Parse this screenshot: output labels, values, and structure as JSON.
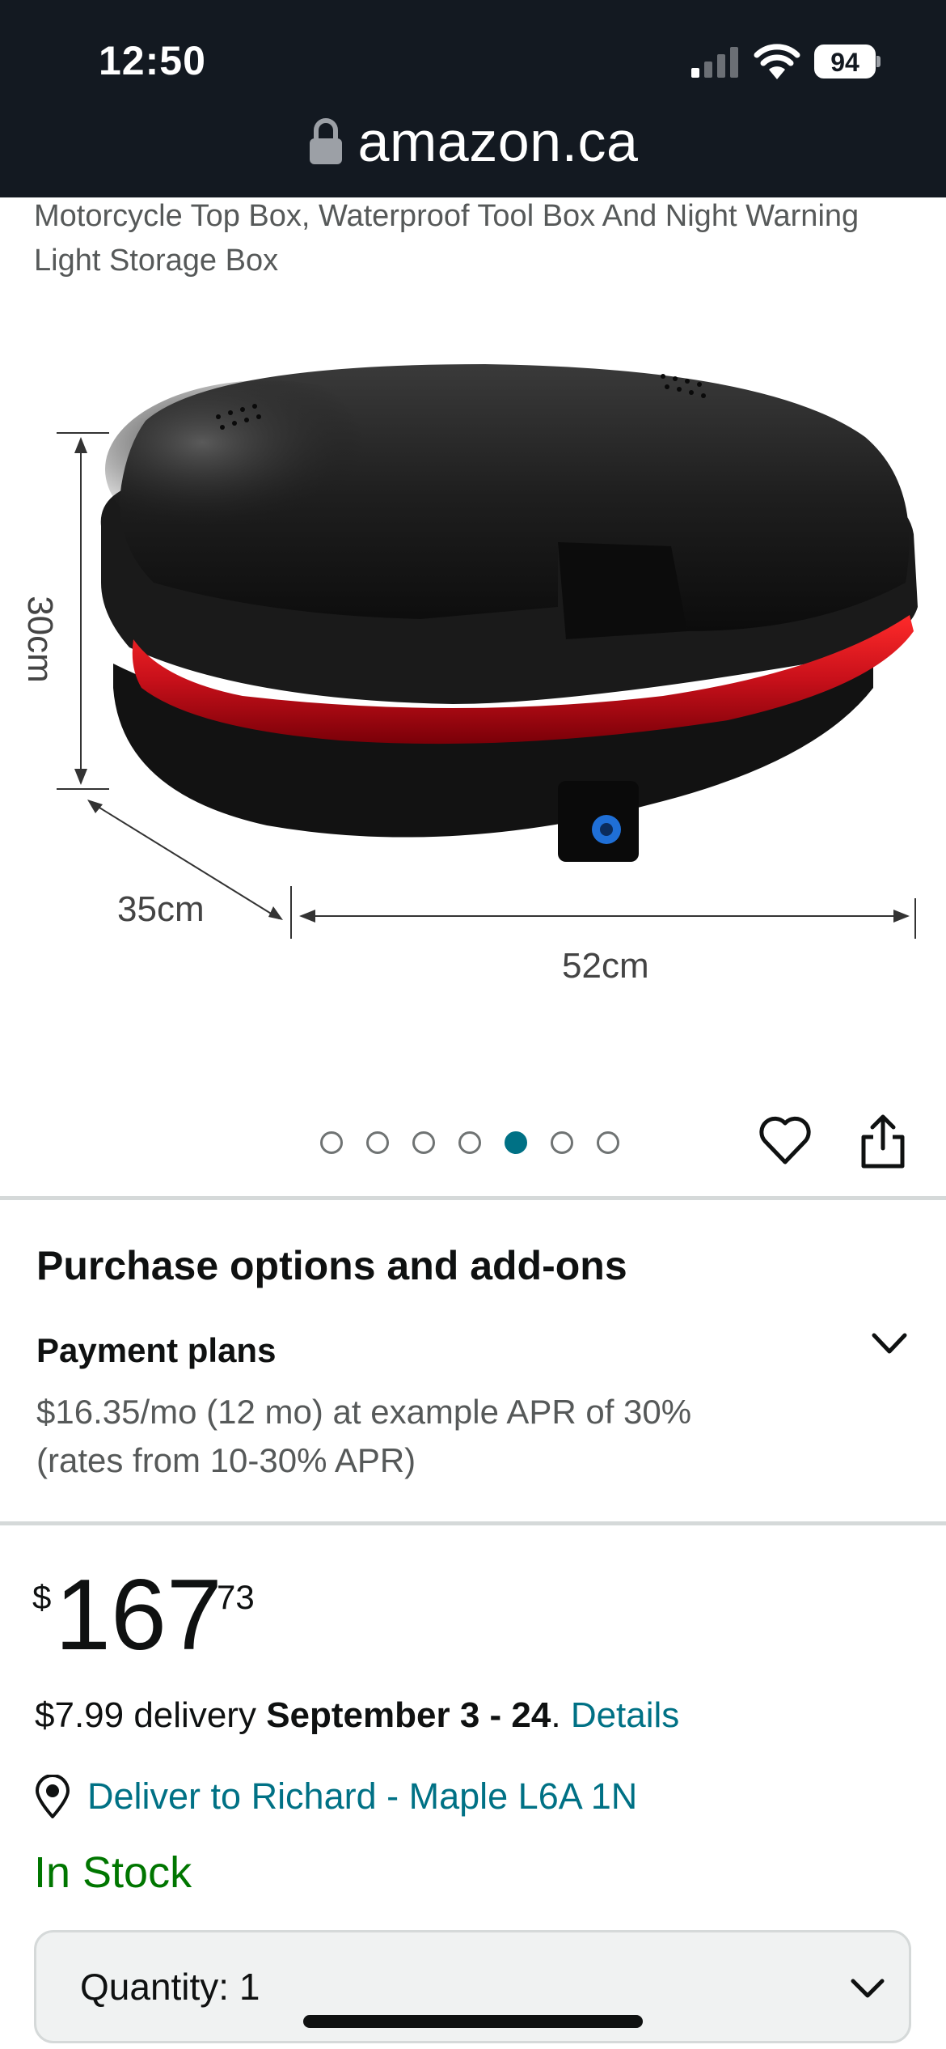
{
  "status_bar": {
    "time": "12:50",
    "battery": "94"
  },
  "browser": {
    "url": "amazon.ca"
  },
  "product": {
    "title": "Motorcycle Top Box, Waterproof Tool Box And Night Warning Light Storage Box",
    "image": {
      "dimension_height": "30cm",
      "dimension_depth": "35cm",
      "dimension_width": "52cm"
    },
    "carousel": {
      "total": 7,
      "active_index": 4
    }
  },
  "purchase_options": {
    "heading": "Purchase options and add-ons",
    "payment_plans_label": "Payment plans",
    "payment_plans_text": "$16.35/mo (12 mo) at example APR of 30% (rates from 10-30% APR)"
  },
  "price": {
    "symbol": "$",
    "whole": "167",
    "fraction": "73"
  },
  "delivery": {
    "cost": "$7.99 delivery",
    "dates": "September 3 - 24",
    "period": ".",
    "details_link": "Details"
  },
  "deliver_to": "Deliver to Richard - Maple L6A 1N",
  "stock_status": "In Stock",
  "quantity": {
    "label": "Quantity:",
    "value": "1"
  },
  "colors": {
    "header_bg": "#131921",
    "link": "#007185",
    "in_stock": "#007600",
    "taillight": "#d0101a"
  }
}
